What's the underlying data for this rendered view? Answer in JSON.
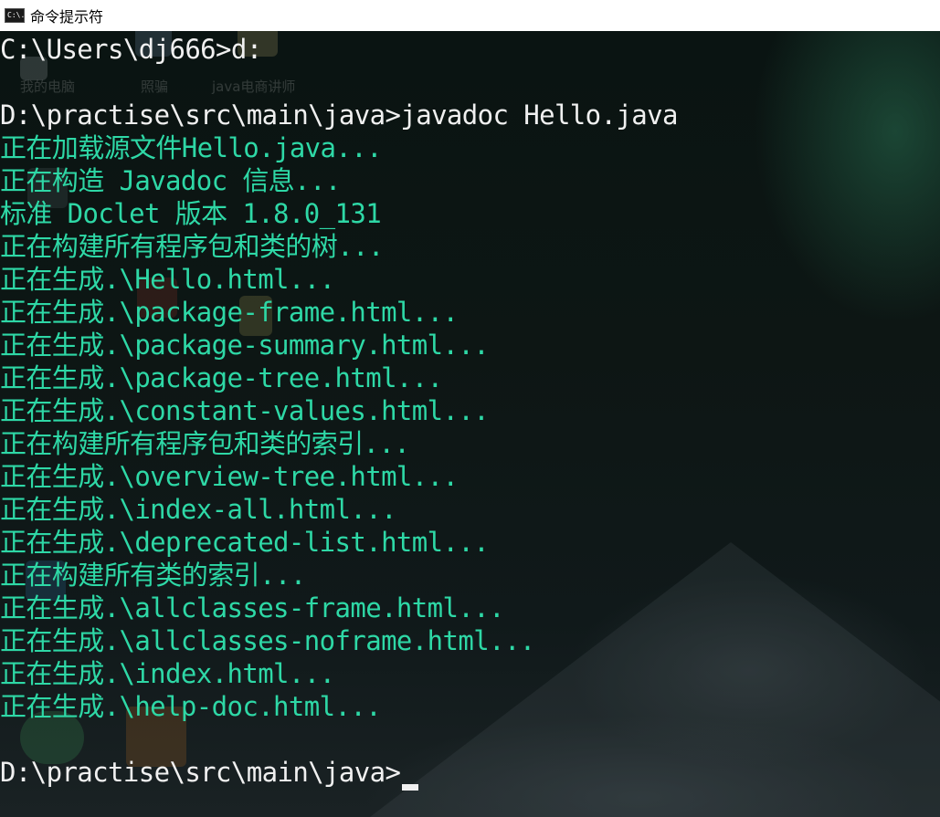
{
  "window": {
    "title": "命令提示符",
    "icon": "cmd-icon",
    "icon_text": "C:\\."
  },
  "desktop_ghosts": [
    "我的电脑",
    "照骗",
    "java电商讲师"
  ],
  "console": {
    "lines": [
      {
        "text": "C:\\Users\\dj666>d:",
        "kind": "prompt"
      },
      {
        "text": "",
        "kind": "blank"
      },
      {
        "text": "D:\\practise\\src\\main\\java>javadoc Hello.java",
        "kind": "prompt"
      },
      {
        "text": "正在加载源文件Hello.java...",
        "kind": "output"
      },
      {
        "text": "正在构造 Javadoc 信息...",
        "kind": "output"
      },
      {
        "text": "标准 Doclet 版本 1.8.0_131",
        "kind": "output"
      },
      {
        "text": "正在构建所有程序包和类的树...",
        "kind": "output"
      },
      {
        "text": "正在生成.\\Hello.html...",
        "kind": "output"
      },
      {
        "text": "正在生成.\\package-frame.html...",
        "kind": "output"
      },
      {
        "text": "正在生成.\\package-summary.html...",
        "kind": "output"
      },
      {
        "text": "正在生成.\\package-tree.html...",
        "kind": "output"
      },
      {
        "text": "正在生成.\\constant-values.html...",
        "kind": "output"
      },
      {
        "text": "正在构建所有程序包和类的索引...",
        "kind": "output"
      },
      {
        "text": "正在生成.\\overview-tree.html...",
        "kind": "output"
      },
      {
        "text": "正在生成.\\index-all.html...",
        "kind": "output"
      },
      {
        "text": "正在生成.\\deprecated-list.html...",
        "kind": "output"
      },
      {
        "text": "正在构建所有类的索引...",
        "kind": "output"
      },
      {
        "text": "正在生成.\\allclasses-frame.html...",
        "kind": "output"
      },
      {
        "text": "正在生成.\\allclasses-noframe.html...",
        "kind": "output"
      },
      {
        "text": "正在生成.\\index.html...",
        "kind": "output"
      },
      {
        "text": "正在生成.\\help-doc.html...",
        "kind": "output"
      },
      {
        "text": "",
        "kind": "blank"
      },
      {
        "text": "D:\\practise\\src\\main\\java>",
        "kind": "prompt"
      }
    ]
  },
  "colors": {
    "output_text": "#2ed8a6",
    "prompt_text": "#f0f0f0",
    "titlebar_bg": "#ffffff"
  }
}
